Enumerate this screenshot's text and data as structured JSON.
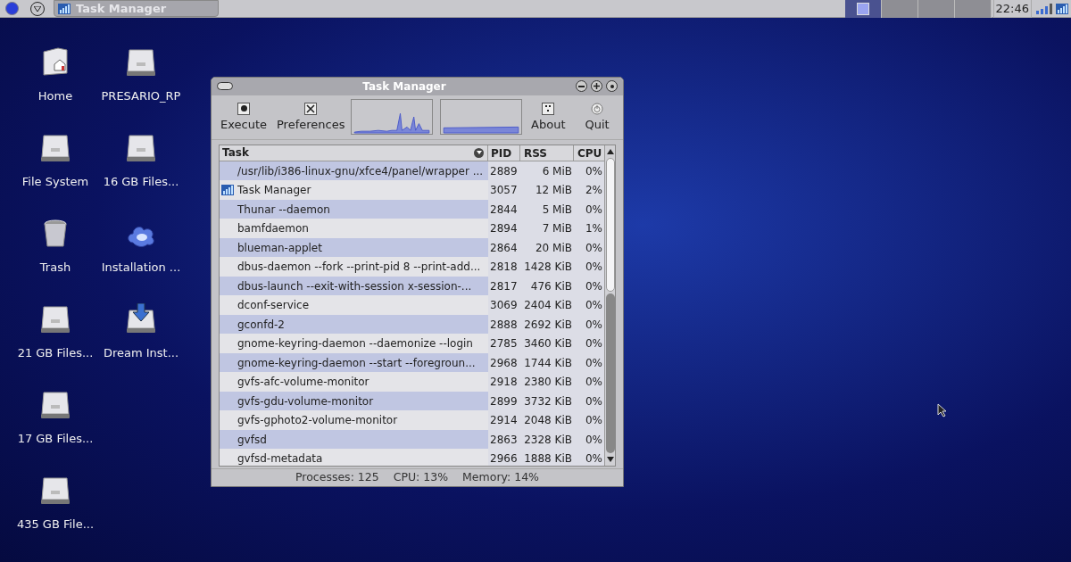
{
  "panel": {
    "taskbar_item": "Task Manager",
    "workspaces": [
      {
        "selected": true
      },
      {
        "selected": false
      },
      {
        "selected": false
      },
      {
        "selected": false
      }
    ],
    "clock": "22:46"
  },
  "desktop_icons": [
    {
      "label": "Home",
      "kind": "home"
    },
    {
      "label": "File System",
      "kind": "drive"
    },
    {
      "label": "Trash",
      "kind": "trash"
    },
    {
      "label": "21 GB Files...",
      "kind": "drive"
    },
    {
      "label": "17 GB Files...",
      "kind": "drive"
    },
    {
      "label": "435 GB File...",
      "kind": "drive"
    },
    {
      "label": "PRESARIO_RP",
      "kind": "drive"
    },
    {
      "label": "16 GB Files...",
      "kind": "drive"
    },
    {
      "label": "Installation ...",
      "kind": "cloud"
    },
    {
      "label": "Dream Inst...",
      "kind": "installer"
    }
  ],
  "window": {
    "title": "Task Manager",
    "toolbar": [
      {
        "label": "Execute",
        "kind": "execute"
      },
      {
        "label": "Preferences",
        "kind": "preferences"
      },
      {
        "label": "About",
        "kind": "about"
      },
      {
        "label": "Quit",
        "kind": "quit"
      }
    ],
    "table": {
      "columns": [
        "Task",
        "PID",
        "RSS",
        "CPU"
      ],
      "rows": [
        {
          "kind": "process",
          "task": "/usr/lib/i386-linux-gnu/xfce4/panel/wrapper ...",
          "pid": "2889",
          "rss": "6 MiB",
          "cpu": "0%"
        },
        {
          "kind": "app",
          "task": "Task Manager",
          "pid": "3057",
          "rss": "12 MiB",
          "cpu": "2%"
        },
        {
          "kind": "process",
          "task": "Thunar --daemon",
          "pid": "2844",
          "rss": "5 MiB",
          "cpu": "0%"
        },
        {
          "kind": "process",
          "task": "bamfdaemon",
          "pid": "2894",
          "rss": "7 MiB",
          "cpu": "1%"
        },
        {
          "kind": "process",
          "task": "blueman-applet",
          "pid": "2864",
          "rss": "20 MiB",
          "cpu": "0%"
        },
        {
          "kind": "process",
          "task": "dbus-daemon --fork --print-pid 8 --print-add...",
          "pid": "2818",
          "rss": "1428 KiB",
          "cpu": "0%"
        },
        {
          "kind": "process",
          "task": "dbus-launch --exit-with-session x-session-...",
          "pid": "2817",
          "rss": "476 KiB",
          "cpu": "0%"
        },
        {
          "kind": "process",
          "task": "dconf-service",
          "pid": "3069",
          "rss": "2404 KiB",
          "cpu": "0%"
        },
        {
          "kind": "process",
          "task": "gconfd-2",
          "pid": "2888",
          "rss": "2692 KiB",
          "cpu": "0%"
        },
        {
          "kind": "process",
          "task": "gnome-keyring-daemon --daemonize --login",
          "pid": "2785",
          "rss": "3460 KiB",
          "cpu": "0%"
        },
        {
          "kind": "process",
          "task": "gnome-keyring-daemon --start --foregroun...",
          "pid": "2968",
          "rss": "1744 KiB",
          "cpu": "0%"
        },
        {
          "kind": "process",
          "task": "gvfs-afc-volume-monitor",
          "pid": "2918",
          "rss": "2380 KiB",
          "cpu": "0%"
        },
        {
          "kind": "process",
          "task": "gvfs-gdu-volume-monitor",
          "pid": "2899",
          "rss": "3732 KiB",
          "cpu": "0%"
        },
        {
          "kind": "process",
          "task": "gvfs-gphoto2-volume-monitor",
          "pid": "2914",
          "rss": "2048 KiB",
          "cpu": "0%"
        },
        {
          "kind": "process",
          "task": "gvfsd",
          "pid": "2863",
          "rss": "2328 KiB",
          "cpu": "0%"
        },
        {
          "kind": "process",
          "task": "gvfsd-metadata",
          "pid": "2966",
          "rss": "1888 KiB",
          "cpu": "0%"
        }
      ]
    },
    "status": [
      "Processes: 125",
      "CPU: 13%",
      "Memory: 14%"
    ]
  }
}
